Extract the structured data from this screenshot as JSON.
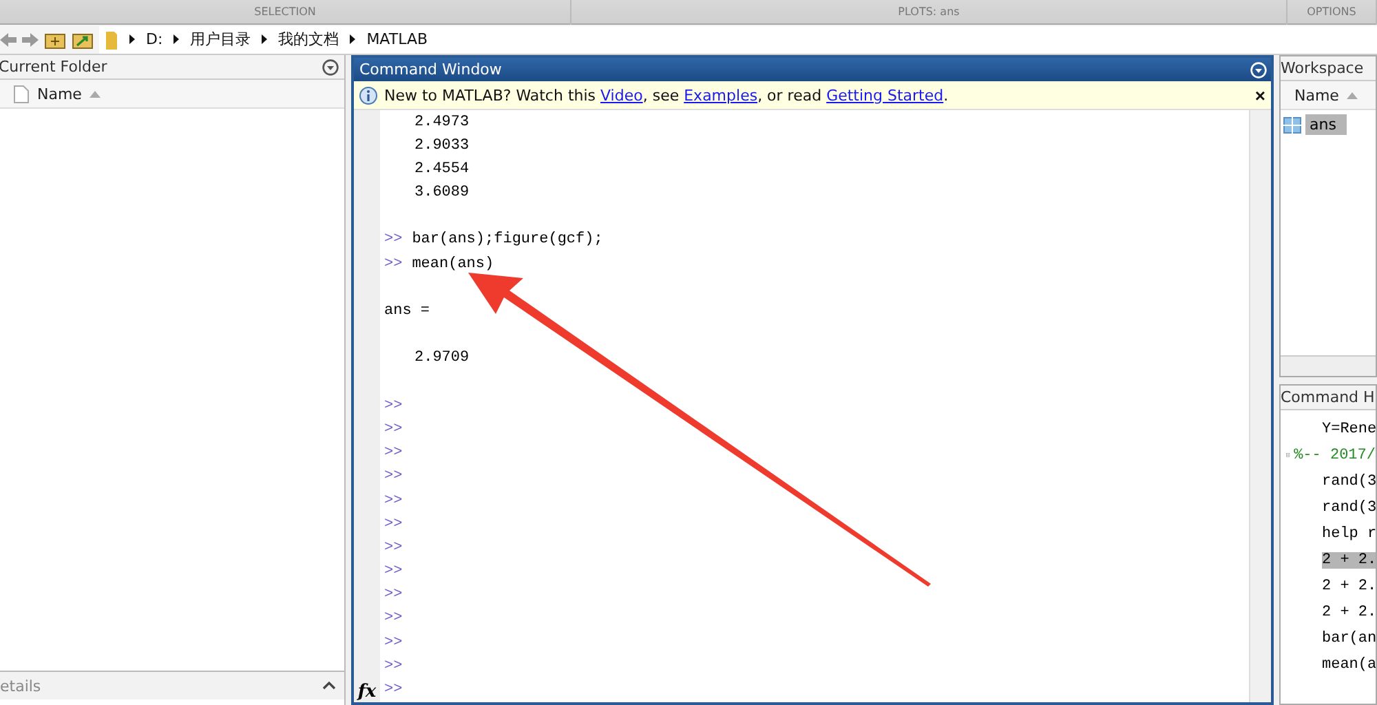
{
  "toolstrip": {
    "sections": [
      "SELECTION",
      "PLOTS: ans",
      "OPTIONS"
    ]
  },
  "address_bar": {
    "path": [
      "D:",
      "用户目录",
      "我的文档",
      "MATLAB"
    ]
  },
  "current_folder": {
    "title": "Current Folder",
    "column": "Name",
    "details": "etails"
  },
  "command_window": {
    "title": "Command Window",
    "info": {
      "parts": [
        {
          "kind": "text",
          "text": "New to MATLAB? Watch this "
        },
        {
          "kind": "link",
          "text": "Video"
        },
        {
          "kind": "text",
          "text": ", see "
        },
        {
          "kind": "link",
          "text": "Examples"
        },
        {
          "kind": "text",
          "text": ", or read "
        },
        {
          "kind": "link",
          "text": "Getting Started"
        },
        {
          "kind": "text",
          "text": "."
        }
      ],
      "close": "×"
    },
    "lines": [
      {
        "kind": "output",
        "text": "2.4973"
      },
      {
        "kind": "output",
        "text": "2.9033"
      },
      {
        "kind": "output",
        "text": "2.4554"
      },
      {
        "kind": "output",
        "text": "3.6089"
      },
      {
        "kind": "gap"
      },
      {
        "kind": "command",
        "prompt": ">>",
        "text": "bar(ans);figure(gcf);"
      },
      {
        "kind": "command",
        "prompt": ">>",
        "text": "mean(ans)"
      },
      {
        "kind": "gap"
      },
      {
        "kind": "label",
        "text": "ans ="
      },
      {
        "kind": "gap"
      },
      {
        "kind": "output",
        "text": "2.9709"
      },
      {
        "kind": "gap"
      },
      {
        "kind": "command",
        "prompt": ">>"
      },
      {
        "kind": "command",
        "prompt": ">>"
      },
      {
        "kind": "command",
        "prompt": ">>"
      },
      {
        "kind": "command",
        "prompt": ">>"
      },
      {
        "kind": "command",
        "prompt": ">>"
      },
      {
        "kind": "command",
        "prompt": ">>"
      },
      {
        "kind": "command",
        "prompt": ">>"
      },
      {
        "kind": "command",
        "prompt": ">>"
      },
      {
        "kind": "command",
        "prompt": ">>"
      },
      {
        "kind": "command",
        "prompt": ">>"
      },
      {
        "kind": "command",
        "prompt": ">>"
      },
      {
        "kind": "command",
        "prompt": ">>"
      }
    ],
    "current_prompt": ">>",
    "function_button": "fx"
  },
  "workspace": {
    "title": "Workspace",
    "column": "Name",
    "items": [
      {
        "name": "ans",
        "selected": true
      }
    ]
  },
  "command_history": {
    "title": "Command H",
    "items": [
      {
        "kind": "command",
        "text": "Y=Rene",
        "selected": false
      },
      {
        "kind": "session",
        "text": "%-- 2017/",
        "expanded": true,
        "children": [
          {
            "kind": "command",
            "text": "rand(3",
            "selected": false
          },
          {
            "kind": "command",
            "text": "rand(3",
            "selected": false
          },
          {
            "kind": "command",
            "text": "help r",
            "selected": false
          },
          {
            "kind": "command",
            "text": "2 + 2.",
            "selected": true
          },
          {
            "kind": "command",
            "text": "2 + 2.",
            "selected": false
          },
          {
            "kind": "command",
            "text": "2 + 2.",
            "selected": false
          },
          {
            "kind": "command",
            "text": "bar(an",
            "selected": false
          },
          {
            "kind": "command",
            "text": "mean(a",
            "selected": false
          }
        ]
      }
    ]
  }
}
